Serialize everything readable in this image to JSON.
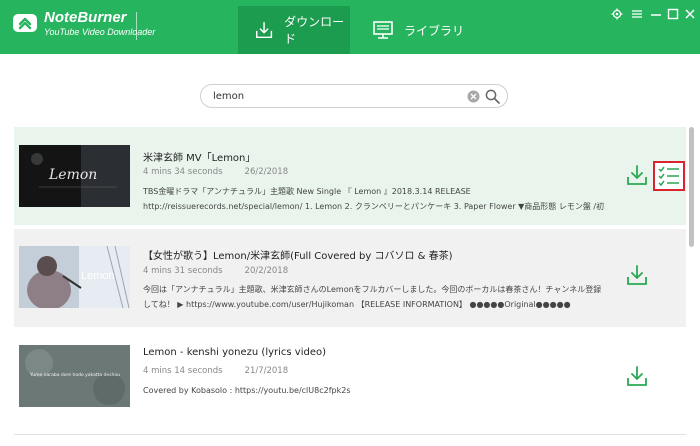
{
  "app": {
    "name": "NoteBurner",
    "subtitle": "YouTube Video Downloader"
  },
  "tabs": [
    {
      "label": "ダウンロード",
      "icon": "download-tray-icon",
      "active": true
    },
    {
      "label": "ライブラリ",
      "icon": "monitor-icon",
      "active": false
    }
  ],
  "window_controls": [
    "gear-icon",
    "menu-icon",
    "minimize-icon",
    "maximize-icon",
    "close-icon"
  ],
  "search": {
    "value": "lemon",
    "placeholder": ""
  },
  "results": [
    {
      "title": "米津玄師 MV「Lemon」",
      "duration": "4 mins 34 seconds",
      "date": "26/2/2018",
      "description": "TBS金曜ドラマ「アンナチュラル」主題歌 New Single 『 Lemon 』2018.3.14 RELEASE http://reissuerecords.net/special/lemon/ 1. Lemon 2. クランベリーとパンケーキ 3. Paper Flower ▼商品形態 レモン盤 /初回限定(CD+レターセット)¥2,000+税 映像盤 / ...",
      "thumb_text": "Lemon"
    },
    {
      "title": "【女性が歌う】Lemon/米津玄師(Full Covered by コバソロ & 春茶)",
      "duration": "4 mins 31 seconds",
      "date": "20/2/2018",
      "description": "今回は「アンナチュラル」主題歌、米津玄師さんのLemonをフルカバーしました。今回のボーカルは春茶さん！チャンネル登録してね！ ▶ https://www.youtube.com/user/Hujikoman 【RELEASE INFORMATION】 ●●●●●Original●●●●● ★2019.3.26...",
      "thumb_text": "Lemon"
    },
    {
      "title": "Lemon - kenshi yonezu (lyrics video)",
      "duration": "4 mins 14 seconds",
      "date": "21/7/2018",
      "description": "Covered by Kobasolo : https://youtu.be/clU8c2fpk2s",
      "thumb_text": "Yume naraba dore hodo yokatta deshou"
    }
  ],
  "colors": {
    "brand_green": "#27b45f",
    "active_tab": "#1c9c4f",
    "download_icon": "#2aa955",
    "highlight_border": "#d9232d"
  }
}
